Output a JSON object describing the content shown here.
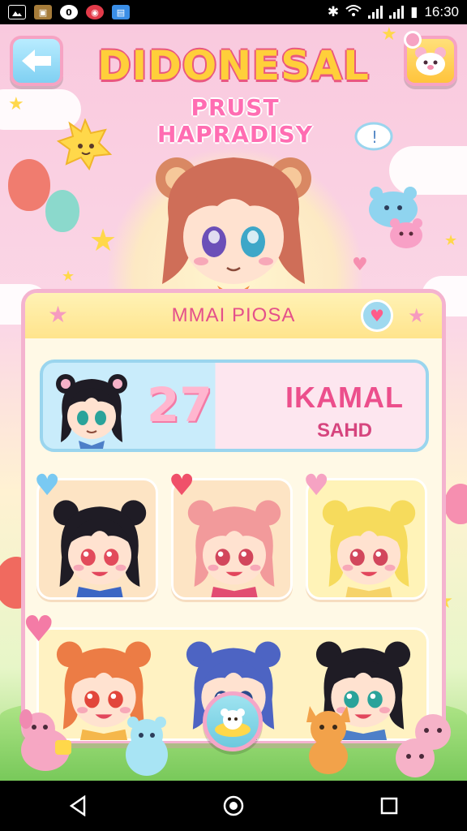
{
  "status_bar": {
    "time": "16:30",
    "notification_icons": [
      "image-icon",
      "box-icon",
      "circle-zero-icon",
      "shield-icon",
      "photo-icon"
    ]
  },
  "header": {
    "title": "DIDONESAL",
    "subtitle": "PRUST HAPRADISY",
    "back_icon": "arrow-left-icon",
    "menu_icon": "bear-menu-icon"
  },
  "panel": {
    "title": "MMAI PIOSA",
    "badge_icon": "heart-icon"
  },
  "featured": {
    "score": "27",
    "name": "IKAMAL",
    "sub": "SAHD"
  },
  "colors": {
    "accent_pink": "#ec4f8c",
    "panel_border": "#f4b3cf",
    "sky_blue": "#9ad5ee",
    "gold": "#ffcf3a"
  },
  "characters_row1": [
    {
      "hair": "#1f1c25",
      "eyes": "#e24a5b",
      "shirt": "#3b66c4",
      "badge": "blue-heart-icon",
      "badge_color": "#79c9f2"
    },
    {
      "hair": "#f29a9b",
      "eyes": "#d2465c",
      "shirt": "#e24c72",
      "badge": "red-heart-icon",
      "badge_color": "#f0506a"
    },
    {
      "hair": "#f6db5c",
      "eyes": "#d2465c",
      "shirt": "#f6d36a",
      "badge": "rainbow-heart-icon",
      "badge_color": "#f6a3c3"
    }
  ],
  "characters_row2": [
    {
      "hair": "#ec7c45",
      "eyes": "#e2463b",
      "shirt": "#f5b74b"
    },
    {
      "hair": "#4d64c3",
      "eyes": "#2b4b8c",
      "shirt": "#6bbd6b"
    },
    {
      "hair": "#1f1c25",
      "eyes": "#2aa39a",
      "shirt": "#4d7fc8"
    }
  ],
  "nav": {
    "back_icon": "nav-back-icon",
    "home_icon": "nav-home-icon",
    "recents_icon": "nav-recents-icon"
  }
}
